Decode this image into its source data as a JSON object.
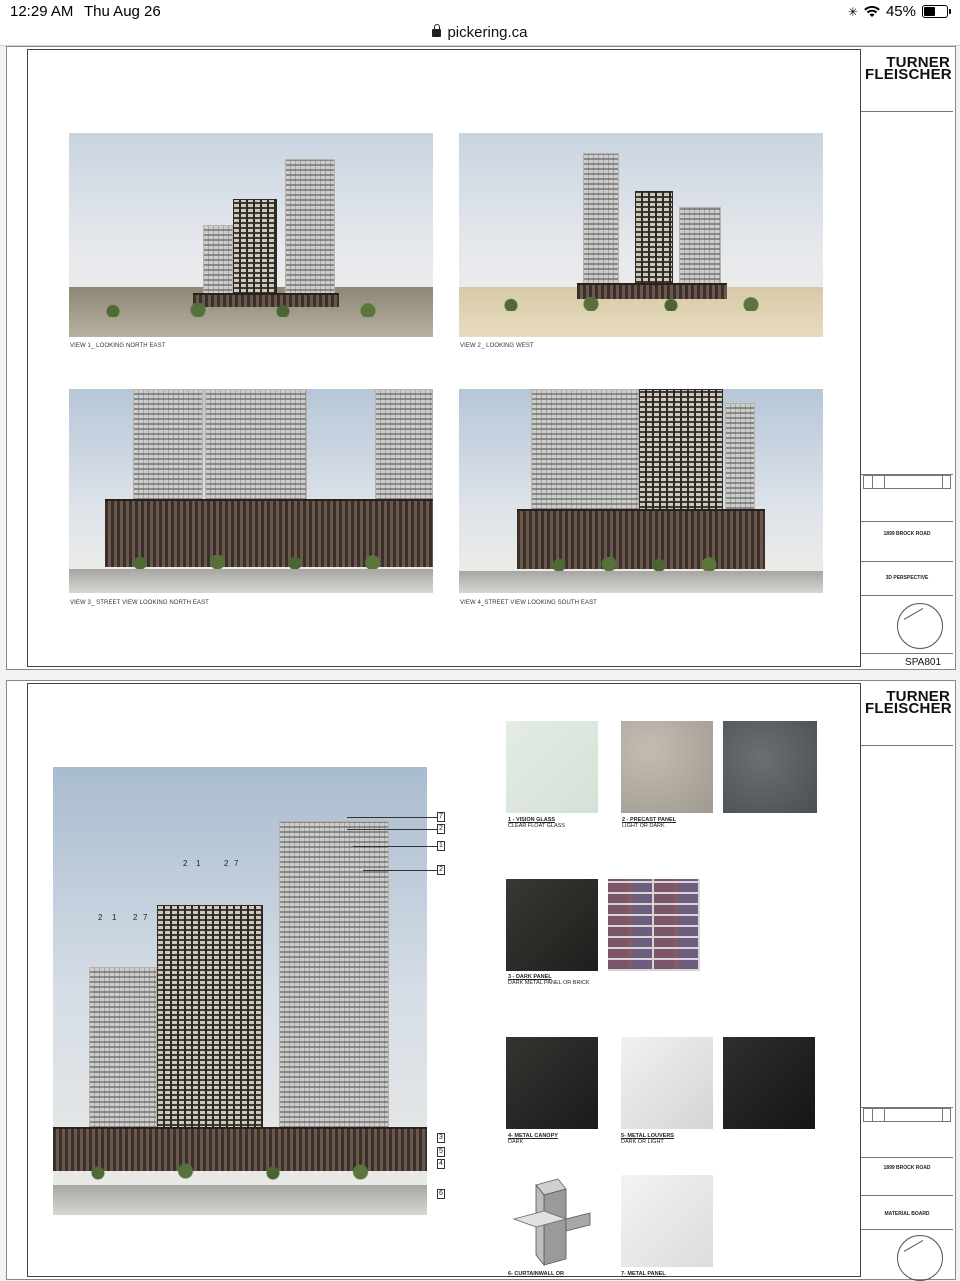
{
  "status": {
    "time": "12:29 AM",
    "date": "Thu Aug 26",
    "battery": "45%"
  },
  "browser": {
    "url": "pickering.ca"
  },
  "sheet1": {
    "logo_line1": "TURNER",
    "logo_line2": "FLEISCHER",
    "project": "1899 BROCK ROAD",
    "drawing": "3D PERSPECTIVE",
    "sheet_number": "SPA801",
    "views": [
      {
        "caption": "VIEW 1_ LOOKING NORTH EAST"
      },
      {
        "caption": "VIEW 2_ LOOKING WEST"
      },
      {
        "caption": "VIEW 3_ STREET VIEW LOOKING NORTH EAST"
      },
      {
        "caption": "VIEW 4_STREET VIEW LOOKING SOUTH EAST"
      }
    ]
  },
  "sheet2": {
    "logo_line1": "TURNER",
    "logo_line2": "FLEISCHER",
    "project": "1899 BROCK ROAD",
    "drawing": "MATERIAL BOARD",
    "materials": [
      {
        "title": "1 - VISION GLASS",
        "desc": "CLEAR FLOAT GLASS",
        "color": "#dfe8de"
      },
      {
        "title": "2 - PRECAST PANEL",
        "desc": "LIGHT OR DARK",
        "color": "#b3ada3"
      },
      {
        "title": "",
        "desc": "",
        "color": "#5b5f63"
      },
      {
        "title": "3 - DARK PANEL",
        "desc": "DARK METAL PANEL OR BRICK",
        "color": "#2f2d2b"
      },
      {
        "title": "",
        "desc": "",
        "color": "#7c5e6c"
      },
      {
        "title": "4- METAL CANOPY",
        "desc": "DARK",
        "color": "#2b2a28"
      },
      {
        "title": "5- METAL LOUVERS",
        "desc": "DARK OR LIGHT",
        "color": "#e6e6e6"
      },
      {
        "title": "",
        "desc": "",
        "color": "#262524"
      },
      {
        "title": "6- CURTAINWALL OR",
        "desc": "",
        "color": "#ffffff"
      },
      {
        "title": "7- METAL PANEL",
        "desc": "",
        "color": "#ededed"
      }
    ],
    "callouts": [
      "7",
      "2",
      "1",
      "2",
      "3",
      "5",
      "4",
      "6"
    ],
    "top_numbers": [
      "2",
      "1",
      "2",
      "7",
      "2",
      "1",
      "2",
      "7"
    ]
  }
}
